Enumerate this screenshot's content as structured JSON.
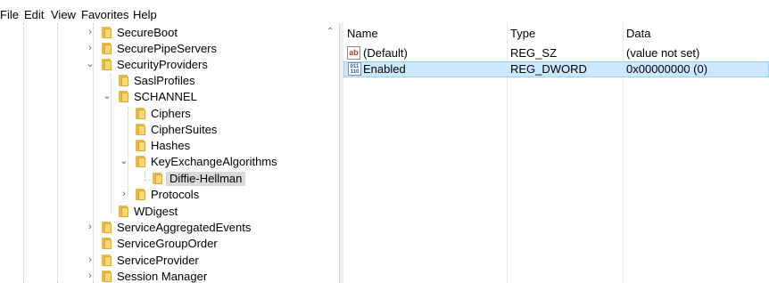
{
  "menu": {
    "file": "File",
    "edit": "Edit",
    "view": "View",
    "favorites": "Favorites",
    "help": "Help"
  },
  "tree": {
    "items": [
      {
        "label": "SecureBoot",
        "expander": "collapsed"
      },
      {
        "label": "SecurePipeServers",
        "expander": "collapsed"
      },
      {
        "label": "SecurityProviders",
        "expander": "expanded"
      },
      {
        "label": "SaslProfiles",
        "expander": "none"
      },
      {
        "label": "SCHANNEL",
        "expander": "expanded"
      },
      {
        "label": "Ciphers",
        "expander": "none"
      },
      {
        "label": "CipherSuites",
        "expander": "none"
      },
      {
        "label": "Hashes",
        "expander": "none"
      },
      {
        "label": "KeyExchangeAlgorithms",
        "expander": "expanded"
      },
      {
        "label": "Diffie-Hellman",
        "expander": "none",
        "selected": true
      },
      {
        "label": "Protocols",
        "expander": "collapsed"
      },
      {
        "label": "WDigest",
        "expander": "none"
      },
      {
        "label": "ServiceAggregatedEvents",
        "expander": "collapsed"
      },
      {
        "label": "ServiceGroupOrder",
        "expander": "none"
      },
      {
        "label": "ServiceProvider",
        "expander": "collapsed"
      },
      {
        "label": "Session Manager",
        "expander": "collapsed"
      }
    ]
  },
  "list": {
    "headers": {
      "name": "Name",
      "type": "Type",
      "data": "Data"
    },
    "rows": [
      {
        "name": "(Default)",
        "type": "REG_SZ",
        "data": "(value not set)",
        "icon": "string-value-icon",
        "icon_text": "ab"
      },
      {
        "name": "Enabled",
        "type": "REG_DWORD",
        "data": "0x00000000 (0)",
        "icon": "binary-value-icon",
        "icon_text": "011 110",
        "selected": true
      }
    ]
  },
  "colors": {
    "selection": "#cce8ff",
    "selection_border": "#99d1ff",
    "tree_selection": "#d9d9d9",
    "folder": "#f8d877"
  }
}
